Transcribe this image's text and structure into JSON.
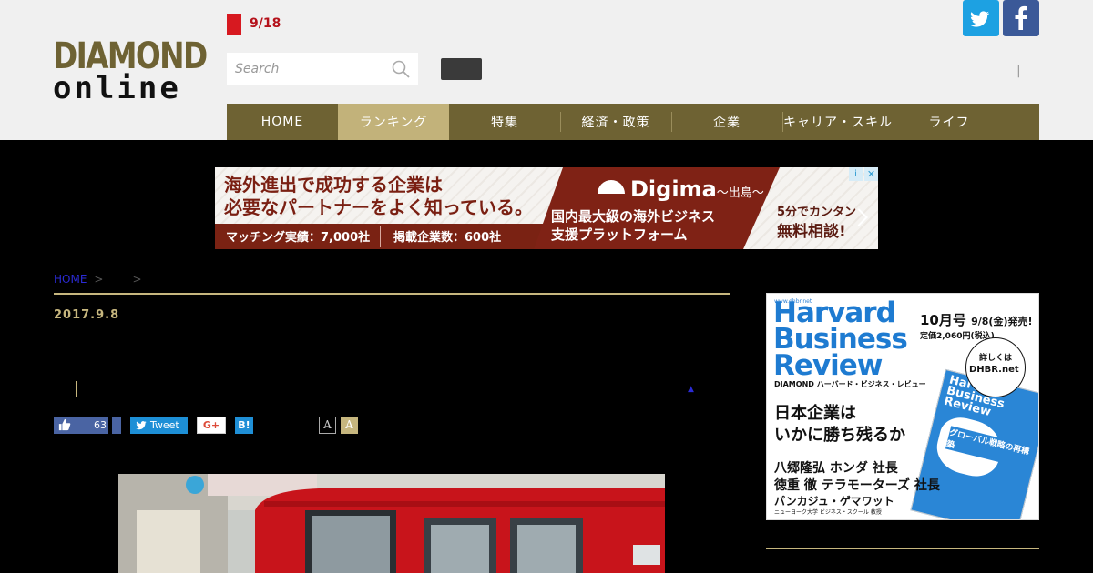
{
  "header": {
    "logo_line1": "DIAMOND",
    "logo_line2": "online",
    "date": "9/18",
    "search_placeholder": "Search",
    "separator": "|",
    "social": {
      "twitter_icon": "twitter-icon",
      "facebook_icon": "facebook-icon"
    }
  },
  "nav": {
    "items": [
      "HOME",
      "ランキング",
      "特集",
      "経済・政策",
      "企業",
      "キャリア・スキル",
      "ライフ"
    ],
    "active_index": 1
  },
  "ad": {
    "headline_1": "海外進出で成功する企業は",
    "headline_2": "必要なパートナーをよく知っている。",
    "stat_1": "マッチング実績：7,000社",
    "stat_2": "掲載企業数：600社",
    "brand": "Digima",
    "brand_sub": "〜出島〜",
    "desc_1": "国内最大級の海外ビジネス",
    "desc_2": "支援プラットフォーム",
    "cta_1": "5分でカンタン",
    "cta_2": "無料相談!",
    "adchoices": "i",
    "close": "✕"
  },
  "breadcrumb": {
    "home": "HOME",
    "sep1": ">",
    "sep2": ">"
  },
  "article": {
    "date": "2017.9.8",
    "triangle": "▲",
    "like_count": "63",
    "tweet_label": "Tweet",
    "gplus_label": "G+",
    "hatena_label": "B!",
    "font_small": "A",
    "font_large": "A"
  },
  "sidebar_ad": {
    "url": "www.dhbr.net",
    "title_1": "Harvard",
    "title_2": "Business",
    "title_3": "Review",
    "issue": "10月号",
    "release": "9/8(金)発売!",
    "price": "定価2,060円(税込)",
    "circle_1": "詳しくは",
    "circle_2": "DHBR.net",
    "sub": "DIAMOND ハーバード・ビジネス・レビュー",
    "lead_1": "日本企業は",
    "lead_2": "いかに勝ち残るか",
    "person_1": "八郷隆弘 ホンダ 社長",
    "person_2": "徳重 徹 テラモーターズ 社長",
    "person_3": "パンカジュ・ゲマワット",
    "person_3_sub": "ニューヨーク大学 ビジネス・スクール 教授",
    "cover_title": "Harvard Business Review",
    "cover_tag": "グローバル戦略の再構築"
  },
  "colors": {
    "nav_bg": "#6e6233",
    "nav_active": "#c2b27a",
    "gold": "#c6b67e",
    "date_red": "#d71920"
  }
}
